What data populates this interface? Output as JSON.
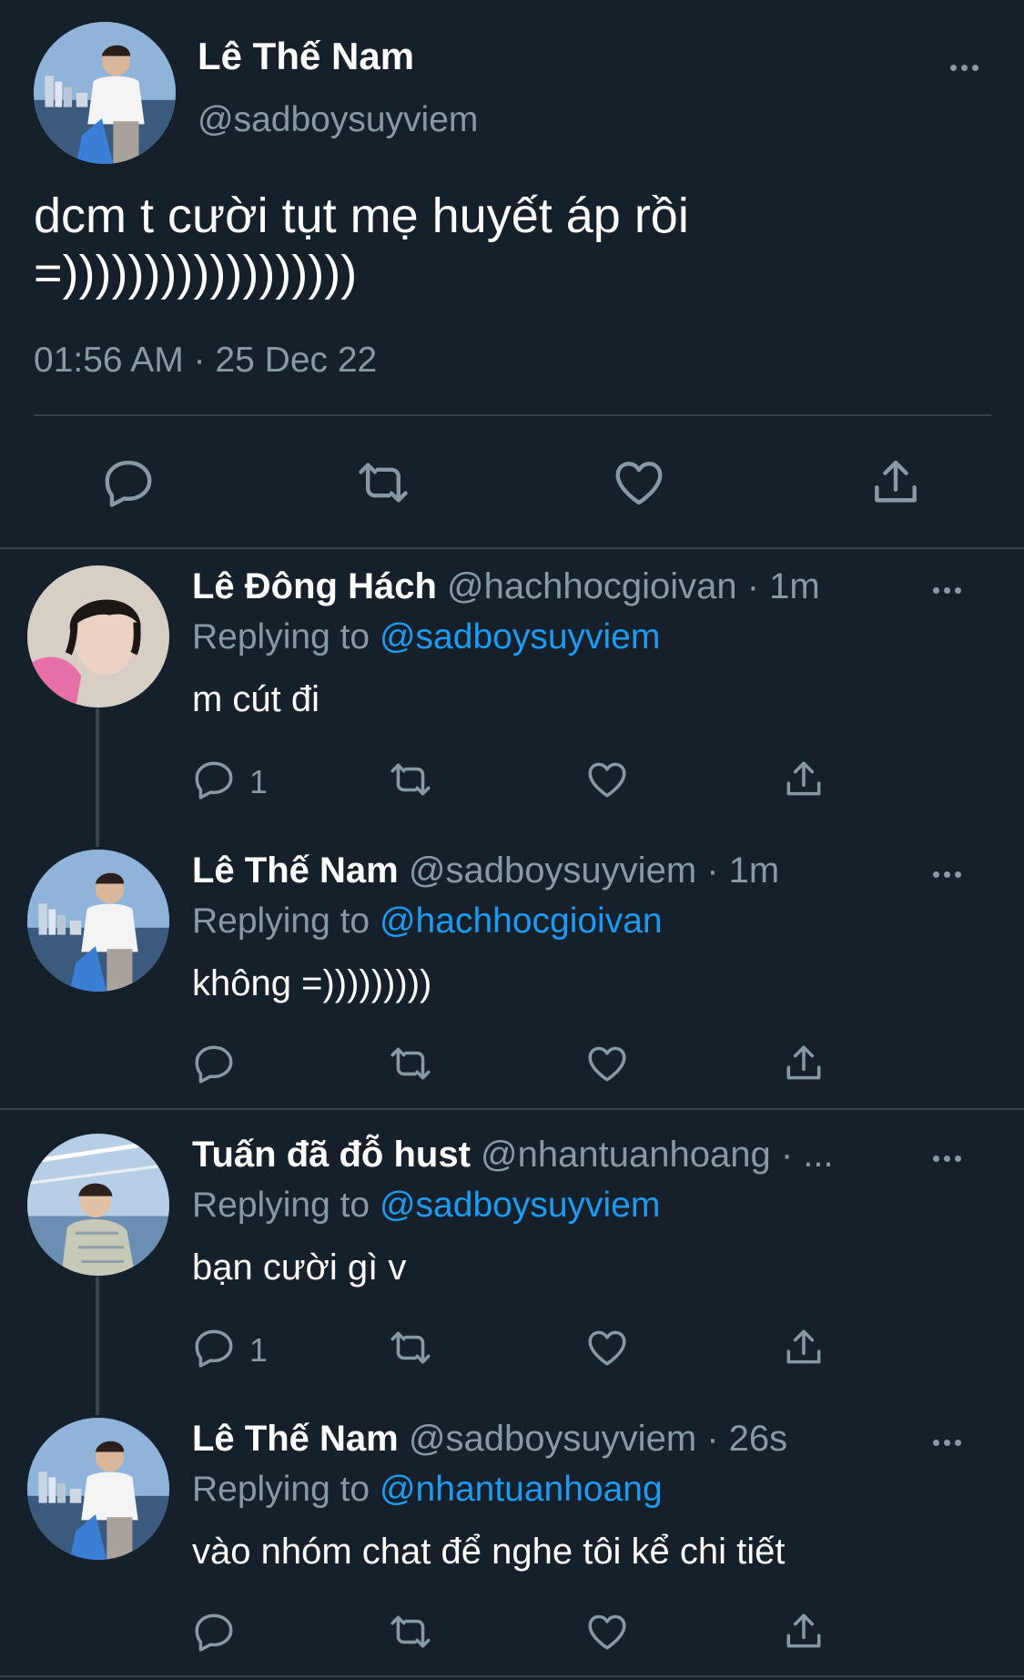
{
  "colors": {
    "background": "#15202b",
    "secondary_text": "#8899a6",
    "accent": "#1d9bf0",
    "divider": "#38444d"
  },
  "main_tweet": {
    "name": "Lê Thế Nam",
    "handle": "@sadboysuyviem",
    "text_line1": "dcm t cười tụt mẹ huyết áp rồi",
    "text_line2": "=))))))))))))))))))",
    "timestamp": "01:56 AM · 25 Dec 22",
    "actions": [
      "reply-icon",
      "retweet-icon",
      "like-icon",
      "share-icon"
    ]
  },
  "replying_label": "Replying to",
  "replies": [
    {
      "name": "Lê Đông Hách",
      "handle": "@hachhocgioivan · 1m",
      "replying_to": "@sadboysuyviem",
      "text": "m cút đi",
      "reply_count": "1"
    },
    {
      "name": "Lê Thế Nam",
      "handle": "@sadboysuyviem · 1m",
      "replying_to": "@hachhocgioivan",
      "text": "không =)))))))))",
      "reply_count": ""
    },
    {
      "name": "Tuấn đã đỗ hust",
      "handle": "@nhantuanhoang · ...",
      "replying_to": "@sadboysuyviem",
      "text": "bạn cười gì v",
      "reply_count": "1"
    },
    {
      "name": "Lê Thế Nam",
      "handle": "@sadboysuyviem · 26s",
      "replying_to": "@nhantuanhoang",
      "text": "vào nhóm chat để nghe tôi kể chi tiết",
      "reply_count": ""
    }
  ]
}
